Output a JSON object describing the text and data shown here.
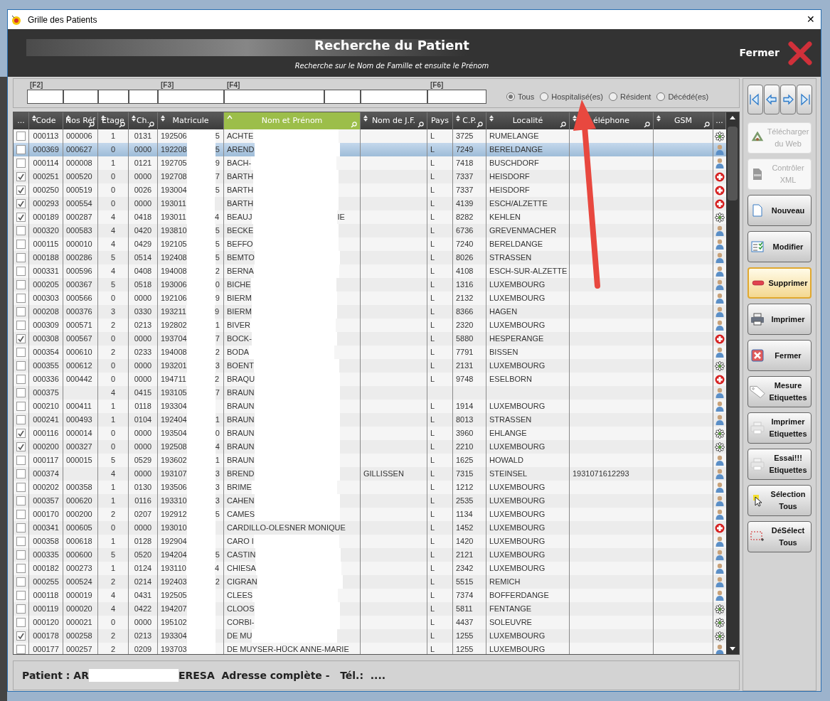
{
  "window": {
    "title": "Grille des Patients",
    "close": "✕"
  },
  "banner": {
    "title": "Recherche du Patient",
    "subtitle": "Recherche sur le Nom de Famille et ensuite le Prénom",
    "close_label": "Fermer"
  },
  "filters": {
    "fields": [
      {
        "kind": "labeled",
        "hotkey": "[F2]"
      },
      {
        "kind": "plain"
      },
      {
        "kind": "plain"
      },
      {
        "kind": "plain"
      },
      {
        "kind": "labeled",
        "hotkey": "[F3]"
      },
      {
        "kind": "labeled",
        "hotkey": "[F4]"
      },
      {
        "kind": "plain"
      },
      {
        "kind": "plain"
      },
      {
        "kind": "labeled",
        "hotkey": "[F6]"
      }
    ],
    "radios": [
      {
        "label": "Tous",
        "selected": true
      },
      {
        "label": "Hospitalisé(es)",
        "selected": false
      },
      {
        "label": "Résident",
        "selected": false
      },
      {
        "label": "Décédé(es)",
        "selected": false
      }
    ]
  },
  "table": {
    "columns": [
      {
        "label": "...",
        "kind": "menu",
        "selected": false
      },
      {
        "label": "Code",
        "kind": "sort",
        "selected": false
      },
      {
        "label": "Nos Réf",
        "kind": "sort_search",
        "selected": false
      },
      {
        "label": "Etage",
        "kind": "sort_search",
        "selected": false
      },
      {
        "label": "Ch.",
        "kind": "sort_search",
        "selected": false
      },
      {
        "label": "Matricule",
        "kind": "sort",
        "selected": false
      },
      {
        "label": "Nom et Prénom",
        "kind": "sort_search",
        "selected": true
      },
      {
        "label": "Nom de J.F.",
        "kind": "sort_search",
        "selected": false
      },
      {
        "label": "Pays",
        "kind": "plain",
        "selected": false
      },
      {
        "label": "C.P.",
        "kind": "sort_search",
        "selected": false
      },
      {
        "label": "Localité",
        "kind": "sort_search",
        "selected": false
      },
      {
        "label": "éléphone",
        "kind": "sort_search",
        "selected": false
      },
      {
        "label": "GSM",
        "kind": "sort_search",
        "selected": false
      },
      {
        "label": "...",
        "kind": "menu",
        "selected": false
      }
    ],
    "rows": [
      {
        "checked": false,
        "selected": false,
        "code": "000113",
        "ref": "000006",
        "etage": "1",
        "ch": "0131",
        "mat": "192506",
        "mat_end": "5",
        "name": "ACHTE",
        "pays": "L",
        "cp": "3725",
        "loc": "RUMELANGE",
        "kind": "flower"
      },
      {
        "checked": false,
        "selected": true,
        "code": "000369",
        "ref": "000627",
        "etage": "0",
        "ch": "0000",
        "mat": "192208",
        "mat_end": "5",
        "name": "AREND",
        "pays": "L",
        "cp": "7249",
        "loc": "BERELDANGE",
        "kind": "person"
      },
      {
        "checked": false,
        "selected": false,
        "code": "000114",
        "ref": "000008",
        "etage": "1",
        "ch": "0121",
        "mat": "192705",
        "mat_end": "9",
        "name": "BACH-",
        "pays": "L",
        "cp": "7418",
        "loc": "BUSCHDORF",
        "kind": "person"
      },
      {
        "checked": true,
        "selected": false,
        "code": "000251",
        "ref": "000520",
        "etage": "0",
        "ch": "0000",
        "mat": "192708",
        "mat_end": "7",
        "name": "BARTH",
        "pays": "L",
        "cp": "7337",
        "loc": "HEISDORF",
        "kind": "cross"
      },
      {
        "checked": true,
        "selected": false,
        "code": "000250",
        "ref": "000519",
        "etage": "0",
        "ch": "0026",
        "mat": "193004",
        "mat_end": "5",
        "name": "BARTH",
        "pays": "L",
        "cp": "7337",
        "loc": "HEISDORF",
        "kind": "cross"
      },
      {
        "checked": true,
        "selected": false,
        "code": "000293",
        "ref": "000554",
        "etage": "0",
        "ch": "0000",
        "mat": "193011",
        "name": "BARTH",
        "pays": "L",
        "cp": "4139",
        "loc": "ESCH/ALZETTE",
        "kind": "cross"
      },
      {
        "checked": true,
        "selected": false,
        "code": "000189",
        "ref": "000287",
        "etage": "4",
        "ch": "0418",
        "mat": "193011",
        "mat_end": "4",
        "name": "BEAUJ",
        "name_end": "IE",
        "pays": "L",
        "cp": "8282",
        "loc": "KEHLEN",
        "kind": "flower"
      },
      {
        "checked": false,
        "selected": false,
        "code": "000320",
        "ref": "000583",
        "etage": "4",
        "ch": "0420",
        "mat": "193810",
        "mat_end": "5",
        "name": "BECKE",
        "pays": "L",
        "cp": "6736",
        "loc": "GREVENMACHER",
        "kind": "person"
      },
      {
        "checked": false,
        "selected": false,
        "code": "000115",
        "ref": "000010",
        "etage": "4",
        "ch": "0429",
        "mat": "192105",
        "mat_end": "5",
        "name": "BEFFO",
        "pays": "L",
        "cp": "7240",
        "loc": "BERELDANGE",
        "kind": "person"
      },
      {
        "checked": false,
        "selected": false,
        "code": "000188",
        "ref": "000286",
        "etage": "5",
        "ch": "0514",
        "mat": "192408",
        "mat_end": "5",
        "name": "BEMTO",
        "pays": "L",
        "cp": "8026",
        "loc": "STRASSEN",
        "kind": "person"
      },
      {
        "checked": false,
        "selected": false,
        "code": "000331",
        "ref": "000596",
        "etage": "4",
        "ch": "0408",
        "mat": "194008",
        "mat_end": "2",
        "name": "BERNA",
        "pays": "L",
        "cp": "4108",
        "loc": "ESCH-SUR-ALZETTE",
        "kind": "person"
      },
      {
        "checked": false,
        "selected": false,
        "code": "000205",
        "ref": "000367",
        "etage": "5",
        "ch": "0518",
        "mat": "193006",
        "mat_end": "0",
        "name": "BICHE",
        "pays": "L",
        "cp": "1316",
        "loc": "LUXEMBOURG",
        "kind": "person"
      },
      {
        "checked": false,
        "selected": false,
        "code": "000303",
        "ref": "000566",
        "etage": "0",
        "ch": "0000",
        "mat": "192106",
        "mat_end": "9",
        "name": "BIERM",
        "pays": "L",
        "cp": "2132",
        "loc": "LUXEMBOURG",
        "kind": "person"
      },
      {
        "checked": false,
        "selected": false,
        "code": "000208",
        "ref": "000376",
        "etage": "3",
        "ch": "0330",
        "mat": "193211",
        "mat_end": "9",
        "name": "BIERM",
        "pays": "L",
        "cp": "8366",
        "loc": "HAGEN",
        "kind": "person"
      },
      {
        "checked": false,
        "selected": false,
        "code": "000309",
        "ref": "000571",
        "etage": "2",
        "ch": "0213",
        "mat": "192802",
        "mat_end": "1",
        "name": "BIVER",
        "pays": "L",
        "cp": "2320",
        "loc": "LUXEMBOURG",
        "kind": "person"
      },
      {
        "checked": true,
        "selected": false,
        "code": "000308",
        "ref": "000567",
        "etage": "0",
        "ch": "0000",
        "mat": "193704",
        "mat_end": "7",
        "name": "BOCK-",
        "pays": "L",
        "cp": "5880",
        "loc": "HESPERANGE",
        "kind": "cross"
      },
      {
        "checked": false,
        "selected": false,
        "code": "000354",
        "ref": "000610",
        "etage": "2",
        "ch": "0233",
        "mat": "194008",
        "mat_end": "2",
        "name": "BODA",
        "pays": "L",
        "cp": "7791",
        "loc": "BISSEN",
        "kind": "person"
      },
      {
        "checked": false,
        "selected": false,
        "code": "000355",
        "ref": "000612",
        "etage": "0",
        "ch": "0000",
        "mat": "193201",
        "mat_end": "3",
        "name": "BOENT",
        "pays": "L",
        "cp": "2131",
        "loc": "LUXEMBOURG",
        "kind": "flower"
      },
      {
        "checked": false,
        "selected": false,
        "code": "000336",
        "ref": "000442",
        "etage": "0",
        "ch": "0000",
        "mat": "194711",
        "mat_end": "2",
        "name": "BRAQU",
        "pays": "L",
        "cp": "9748",
        "loc": "ESELBORN",
        "kind": "cross"
      },
      {
        "checked": false,
        "selected": false,
        "code": "000375",
        "etage": "4",
        "ch": "0415",
        "mat": "193105",
        "mat_end": "7",
        "name": "BRAUN",
        "kind": "person"
      },
      {
        "checked": false,
        "selected": false,
        "code": "000210",
        "ref": "000411",
        "etage": "1",
        "ch": "0118",
        "mat": "193304",
        "name": "BRAUN",
        "pays": "L",
        "cp": "1914",
        "loc": "LUXEMBOURG",
        "kind": "person"
      },
      {
        "checked": false,
        "selected": false,
        "code": "000241",
        "ref": "000493",
        "etage": "1",
        "ch": "0104",
        "mat": "192404",
        "mat_end": "1",
        "name": "BRAUN",
        "pays": "L",
        "cp": "8013",
        "loc": "STRASSEN",
        "kind": "person"
      },
      {
        "checked": true,
        "selected": false,
        "code": "000116",
        "ref": "000014",
        "etage": "0",
        "ch": "0000",
        "mat": "193504",
        "mat_end": "0",
        "name": "BRAUN",
        "pays": "L",
        "cp": "3960",
        "loc": "EHLANGE",
        "kind": "flower"
      },
      {
        "checked": true,
        "selected": false,
        "code": "000200",
        "ref": "000327",
        "etage": "0",
        "ch": "0000",
        "mat": "192508",
        "mat_end": "4",
        "name": "BRAUN",
        "pays": "L",
        "cp": "2210",
        "loc": "LUXEMBOURG",
        "kind": "flower"
      },
      {
        "checked": false,
        "selected": false,
        "code": "000117",
        "ref": "000015",
        "etage": "5",
        "ch": "0529",
        "mat": "193602",
        "mat_end": "1",
        "name": "BRAUN",
        "pays": "L",
        "cp": "1625",
        "loc": "HOWALD",
        "kind": "person"
      },
      {
        "checked": false,
        "selected": false,
        "code": "000374",
        "etage": "4",
        "ch": "0000",
        "mat": "193107",
        "mat_end": "3",
        "name": "BREND",
        "jf": "GILLISSEN",
        "pays": "L",
        "cp": "7315",
        "loc": "STEINSEL",
        "tel": "1931071612293",
        "kind": "person"
      },
      {
        "checked": false,
        "selected": false,
        "code": "000202",
        "ref": "000358",
        "etage": "1",
        "ch": "0130",
        "mat": "193506",
        "mat_end": "3",
        "name": "BRIME",
        "pays": "L",
        "cp": "1212",
        "loc": "LUXEMBOURG",
        "kind": "person"
      },
      {
        "checked": false,
        "selected": false,
        "code": "000357",
        "ref": "000620",
        "etage": "1",
        "ch": "0116",
        "mat": "193310",
        "mat_end": "3",
        "name": "CAHEN",
        "pays": "L",
        "cp": "2535",
        "loc": "LUXEMBOURG",
        "kind": "person"
      },
      {
        "checked": false,
        "selected": false,
        "code": "000170",
        "ref": "000200",
        "etage": "2",
        "ch": "0207",
        "mat": "192912",
        "mat_end": "5",
        "name": "CAMES",
        "pays": "L",
        "cp": "1134",
        "loc": "LUXEMBOURG",
        "kind": "person"
      },
      {
        "checked": false,
        "selected": false,
        "code": "000341",
        "ref": "000605",
        "etage": "0",
        "ch": "0000",
        "mat": "193010",
        "name": "CARDILLO-OLESNER MONIQUE",
        "pays": "L",
        "cp": "1452",
        "loc": "LUXEMBOURG",
        "kind": "cross"
      },
      {
        "checked": false,
        "selected": false,
        "code": "000358",
        "ref": "000618",
        "etage": "1",
        "ch": "0128",
        "mat": "192904",
        "name": "CARO I",
        "pays": "L",
        "cp": "1420",
        "loc": "LUXEMBOURG",
        "kind": "person"
      },
      {
        "checked": false,
        "selected": false,
        "code": "000335",
        "ref": "000600",
        "etage": "5",
        "ch": "0520",
        "mat": "194204",
        "mat_end": "5",
        "name": "CASTIN",
        "pays": "L",
        "cp": "2121",
        "loc": "LUXEMBOURG",
        "kind": "person"
      },
      {
        "checked": false,
        "selected": false,
        "code": "000182",
        "ref": "000273",
        "etage": "1",
        "ch": "0124",
        "mat": "193110",
        "mat_end": "4",
        "name": "CHIESA",
        "pays": "L",
        "cp": "2342",
        "loc": "LUXEMBOURG",
        "kind": "person"
      },
      {
        "checked": false,
        "selected": false,
        "code": "000255",
        "ref": "000524",
        "etage": "2",
        "ch": "0214",
        "mat": "192403",
        "mat_end": "2",
        "name": "CIGRAN",
        "pays": "L",
        "cp": "5515",
        "loc": "REMICH",
        "kind": "person"
      },
      {
        "checked": false,
        "selected": false,
        "code": "000118",
        "ref": "000019",
        "etage": "4",
        "ch": "0431",
        "mat": "192505",
        "name": "CLEES",
        "pays": "L",
        "cp": "7374",
        "loc": "BOFFERDANGE",
        "kind": "person"
      },
      {
        "checked": false,
        "selected": false,
        "code": "000119",
        "ref": "000020",
        "etage": "4",
        "ch": "0422",
        "mat": "194207",
        "name": "CLOOS",
        "pays": "L",
        "cp": "5811",
        "loc": "FENTANGE",
        "kind": "flower"
      },
      {
        "checked": false,
        "selected": false,
        "code": "000120",
        "ref": "000021",
        "etage": "0",
        "ch": "0000",
        "mat": "195102",
        "name": "CORBI-",
        "pays": "L",
        "cp": "4437",
        "loc": "SOLEUVRE",
        "kind": "flower"
      },
      {
        "checked": true,
        "selected": false,
        "code": "000178",
        "ref": "000258",
        "etage": "2",
        "ch": "0213",
        "mat": "193304",
        "name": "DE MU",
        "pays": "L",
        "cp": "1255",
        "loc": "LUXEMBOURG",
        "kind": "flower"
      },
      {
        "checked": false,
        "selected": false,
        "code": "000177",
        "ref": "000257",
        "etage": "2",
        "ch": "0209",
        "mat": "193703",
        "name": "DE MUYSER-HÜCK ANNE-MARIE",
        "pays": "L",
        "cp": "1255",
        "loc": "LUXEMBOURG",
        "kind": "person"
      }
    ]
  },
  "footer": {
    "prefix": "Patient : AR",
    "suffix": "ERESA  Adresse complète -   Tél.:  ...."
  },
  "sidebar": {
    "nav": [
      {
        "kind": "first"
      },
      {
        "kind": "prev"
      },
      {
        "kind": "next"
      },
      {
        "kind": "last"
      }
    ],
    "buttons": [
      {
        "lines": [
          "Télécharger",
          "du Web"
        ],
        "kind": "recycle",
        "disabled": true,
        "focused": false
      },
      {
        "lines": [
          "Contrôler",
          "XML"
        ],
        "kind": "xml",
        "disabled": true,
        "focused": false
      },
      {
        "lines": [
          "Nouveau"
        ],
        "kind": "document",
        "disabled": false,
        "focused": false
      },
      {
        "lines": [
          "Modifier"
        ],
        "kind": "checklist",
        "disabled": false,
        "focused": false
      },
      {
        "lines": [
          "Supprimer"
        ],
        "kind": "minus",
        "disabled": false,
        "focused": true
      },
      {
        "lines": [
          "Imprimer"
        ],
        "kind": "printer",
        "disabled": false,
        "focused": false
      },
      {
        "lines": [
          "Fermer"
        ],
        "kind": "close",
        "disabled": false,
        "focused": false
      },
      {
        "lines": [
          "Mesure",
          "Etiquettes"
        ],
        "kind": "tag",
        "disabled": false,
        "focused": false
      },
      {
        "lines": [
          "Imprimer",
          "Etiquettes"
        ],
        "kind": "printer_faded",
        "disabled": false,
        "focused": false
      },
      {
        "lines": [
          "Essai!!!",
          "Etiquettes"
        ],
        "kind": "printer_faded",
        "disabled": false,
        "focused": false
      },
      {
        "lines": [
          "Sélection",
          "Tous"
        ],
        "kind": "cursor",
        "disabled": false,
        "focused": false
      },
      {
        "lines": [
          "DéSélect",
          "Tous"
        ],
        "kind": "dashed",
        "disabled": false,
        "focused": false
      }
    ]
  }
}
